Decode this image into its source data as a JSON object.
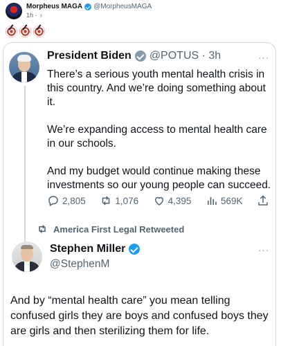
{
  "outer_post": {
    "display_name": "Morpheus MAGA",
    "handle": "@MorpheusMAGA",
    "time": "1h · ♁",
    "emoji_count": 3
  },
  "quoted_tweet": {
    "name": "President Biden",
    "handle_time": "@POTUS · 3h",
    "more": "···",
    "paragraphs": [
      "There’s a serious youth mental health crisis in this country. And we’re doing something about it.",
      "We’re expanding access to mental health care in our schools.",
      "And my budget would continue making these investments so our young people can succeed."
    ],
    "actions": {
      "replies": "2,805",
      "retweets": "1,076",
      "likes": "4,395",
      "views": "569K"
    }
  },
  "retweet_context": "America First Legal Retweeted",
  "reply_tweet": {
    "name": "Stephen Miller",
    "handle": "@StephenM",
    "more": "···",
    "text": "And by “mental health care” you mean telling confused girls they are boys and confused boys they are girls and then sterilizing them for life."
  },
  "colors": {
    "accent": "#1d9bf0",
    "muted": "#536471",
    "border": "#cfd9de",
    "gov_badge": "#829aab"
  }
}
